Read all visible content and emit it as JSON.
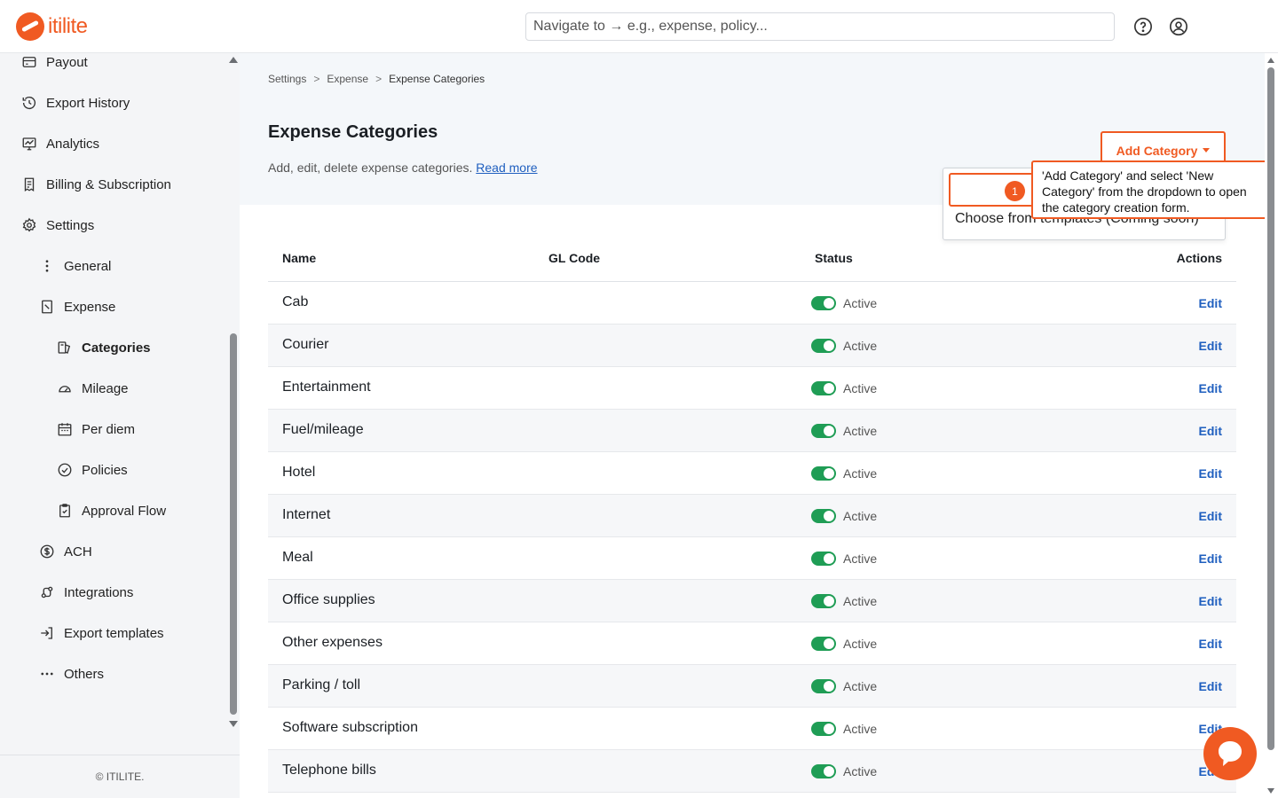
{
  "brand": {
    "name": "itilite",
    "accent": "#f05a22",
    "link": "#1f5fbf",
    "toggle_on": "#1f9d55"
  },
  "topbar": {
    "search_placeholder": "Navigate to → e.g., expense, policy...",
    "icons": [
      "help-circle-icon",
      "user-circle-icon"
    ]
  },
  "sidebar": {
    "items": [
      {
        "label": "Payout",
        "icon": "wallet-icon"
      },
      {
        "label": "Export History",
        "icon": "history-icon"
      },
      {
        "label": "Analytics",
        "icon": "chart-icon"
      },
      {
        "label": "Billing & Subscription",
        "icon": "receipt-icon"
      },
      {
        "label": "Settings",
        "icon": "gear-icon"
      },
      {
        "label": "General",
        "icon": "dots-vertical-icon"
      },
      {
        "label": "Expense",
        "icon": "expense-icon"
      },
      {
        "label": "Categories",
        "icon": "categories-icon",
        "active": true
      },
      {
        "label": "Mileage",
        "icon": "gauge-icon"
      },
      {
        "label": "Per diem",
        "icon": "calendar-icon"
      },
      {
        "label": "Policies",
        "icon": "check-circle-icon"
      },
      {
        "label": "Approval Flow",
        "icon": "clipboard-check-icon"
      },
      {
        "label": "ACH",
        "icon": "dollar-circle-icon"
      },
      {
        "label": "Integrations",
        "icon": "integrations-icon"
      },
      {
        "label": "Export templates",
        "icon": "export-icon"
      },
      {
        "label": "Others",
        "icon": "dots-horizontal-icon"
      }
    ],
    "footer": "© ITILITE."
  },
  "breadcrumb": [
    "Settings",
    "Expense",
    "Expense Categories"
  ],
  "page": {
    "title": "Expense Categories",
    "description": "Add, edit, delete expense categories.",
    "read_more": "Read more",
    "add_button": "Add Category"
  },
  "dropdown": {
    "template_option": "Choose from templates (Coming soon)"
  },
  "walkthrough": {
    "step": "1",
    "tooltip": "'Add Category' and select 'New Category' from the dropdown to open the category creation form."
  },
  "table": {
    "headers": {
      "name": "Name",
      "gl_code": "GL Code",
      "status": "Status",
      "actions": "Actions"
    },
    "rows": [
      {
        "name": "Cab",
        "status": "Active",
        "action": "Edit"
      },
      {
        "name": "Courier",
        "status": "Active",
        "action": "Edit"
      },
      {
        "name": "Entertainment",
        "status": "Active",
        "action": "Edit"
      },
      {
        "name": "Fuel/mileage",
        "status": "Active",
        "action": "Edit"
      },
      {
        "name": "Hotel",
        "status": "Active",
        "action": "Edit"
      },
      {
        "name": "Internet",
        "status": "Active",
        "action": "Edit"
      },
      {
        "name": "Meal",
        "status": "Active",
        "action": "Edit"
      },
      {
        "name": "Office supplies",
        "status": "Active",
        "action": "Edit"
      },
      {
        "name": "Other expenses",
        "status": "Active",
        "action": "Edit"
      },
      {
        "name": "Parking / toll",
        "status": "Active",
        "action": "Edit"
      },
      {
        "name": "Software subscription",
        "status": "Active",
        "action": "Edit"
      },
      {
        "name": "Telephone bills",
        "status": "Active",
        "action": "Edit"
      }
    ]
  }
}
